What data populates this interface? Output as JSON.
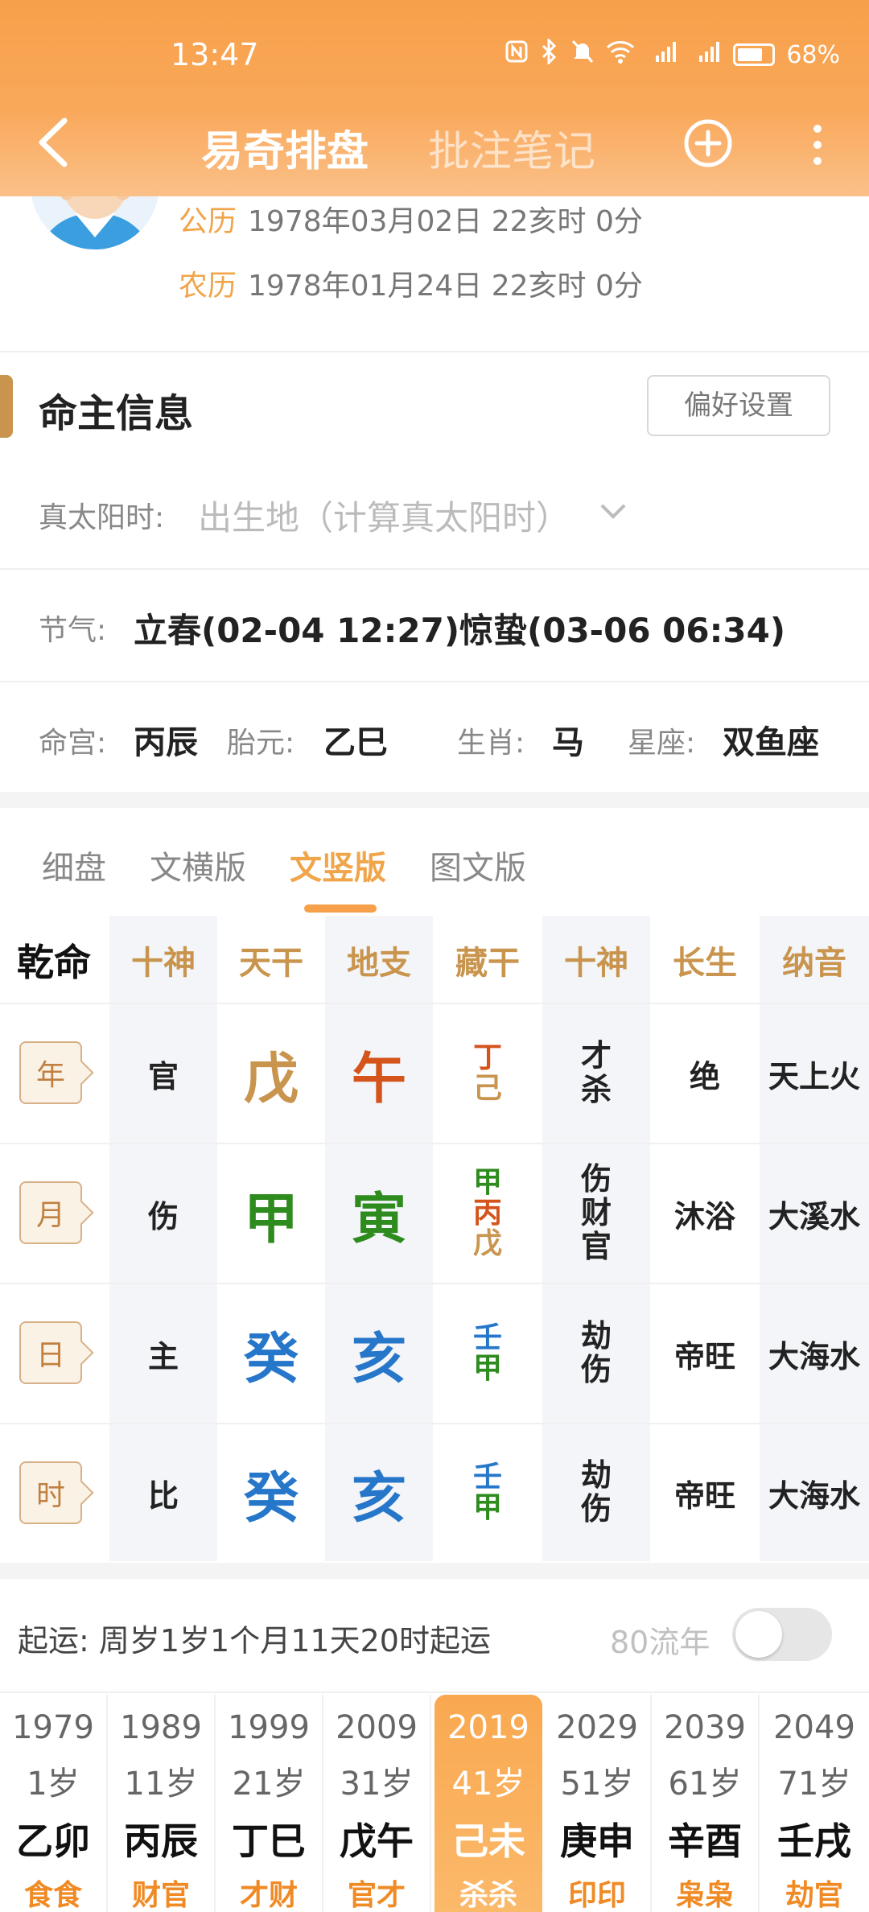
{
  "status": {
    "time": "13:47",
    "battery": "68%",
    "icons": [
      "nfc-icon",
      "bluetooth-icon",
      "mute-icon",
      "wifi-icon",
      "signal-5g-icon",
      "signal-4g-icon",
      "battery-icon"
    ]
  },
  "nav": {
    "tab_active": "易奇排盘",
    "tab_inactive": "批注笔记"
  },
  "profile": {
    "gongli_label": "公历",
    "gongli_value": "1978年03月02日 22亥时 0分",
    "nongli_label": "农历",
    "nongli_value": "1978年01月24日 22亥时 0分"
  },
  "info": {
    "title": "命主信息",
    "pref_button": "偏好设置",
    "solar_label": "真太阳时:",
    "solar_placeholder": "出生地（计算真太阳时）",
    "jieqi_label": "节气:",
    "jieqi_value": "立春(02-04 12:27)惊蛰(03-06 06:34)",
    "minggong_label": "命宫:",
    "minggong_value": "丙辰",
    "taiyuan_label": "胎元:",
    "taiyuan_value": "乙巳",
    "shengxiao_label": "生肖:",
    "shengxiao_value": "马",
    "xingzuo_label": "星座:",
    "xingzuo_value": "双鱼座"
  },
  "view_tabs": [
    "细盘",
    "文横版",
    "文竖版",
    "图文版"
  ],
  "view_tab_active": "文竖版",
  "chart": {
    "title": "乾命",
    "headers": [
      "十神",
      "天干",
      "地支",
      "藏干",
      "十神",
      "长生",
      "纳音"
    ],
    "rows": [
      {
        "pillar": "年",
        "shishen": "官",
        "gan": "戊",
        "zhi": "午",
        "canggan": [
          "丁",
          "己"
        ],
        "cang_shishen": [
          "才",
          "杀"
        ],
        "changsheng": "绝",
        "nayin": "天上火"
      },
      {
        "pillar": "月",
        "shishen": "伤",
        "gan": "甲",
        "zhi": "寅",
        "canggan": [
          "甲",
          "丙",
          "戊"
        ],
        "cang_shishen": [
          "伤",
          "财",
          "官"
        ],
        "changsheng": "沐浴",
        "nayin": "大溪水"
      },
      {
        "pillar": "日",
        "shishen": "主",
        "gan": "癸",
        "zhi": "亥",
        "canggan": [
          "壬",
          "甲"
        ],
        "cang_shishen": [
          "劫",
          "伤"
        ],
        "changsheng": "帝旺",
        "nayin": "大海水"
      },
      {
        "pillar": "时",
        "shishen": "比",
        "gan": "癸",
        "zhi": "亥",
        "canggan": [
          "壬",
          "甲"
        ],
        "cang_shishen": [
          "劫",
          "伤"
        ],
        "changsheng": "帝旺",
        "nayin": "大海水"
      }
    ],
    "colors": {
      "earth": "#c9954e",
      "fire": "#d4541c",
      "wood": "#2e8b1e",
      "water": "#2677c9"
    }
  },
  "luck": {
    "qiyun_text": "起运:  周岁1岁1个月11天20时起运",
    "liunian_label": "80流年",
    "toggle_on": false,
    "decades": [
      {
        "year": "1979",
        "age": "1岁",
        "ganzhi": "乙卯",
        "shishen": "食食"
      },
      {
        "year": "1989",
        "age": "11岁",
        "ganzhi": "丙辰",
        "shishen": "财官"
      },
      {
        "year": "1999",
        "age": "21岁",
        "ganzhi": "丁巳",
        "shishen": "才财"
      },
      {
        "year": "2009",
        "age": "31岁",
        "ganzhi": "戊午",
        "shishen": "官才"
      },
      {
        "year": "2019",
        "age": "41岁",
        "ganzhi": "己未",
        "shishen": "杀杀"
      },
      {
        "year": "2029",
        "age": "51岁",
        "ganzhi": "庚申",
        "shishen": "印印"
      },
      {
        "year": "2039",
        "age": "61岁",
        "ganzhi": "辛酉",
        "shishen": "枭枭"
      },
      {
        "year": "2049",
        "age": "71岁",
        "ganzhi": "壬戌",
        "shishen": "劫官"
      }
    ],
    "selected": "2019"
  }
}
